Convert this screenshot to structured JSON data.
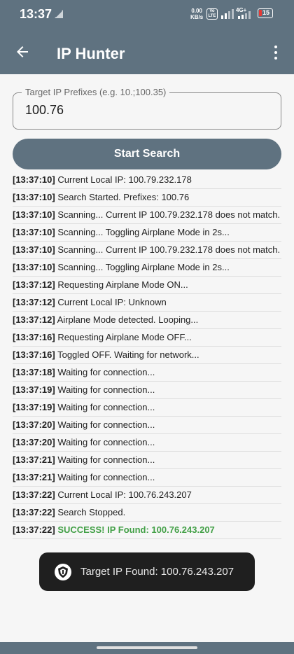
{
  "status_bar": {
    "time": "13:37",
    "net_speed_value": "0.00",
    "net_speed_unit": "KB/s",
    "volte_label_top": "Vo",
    "volte_label_bottom": "LTE",
    "network_type": "4G+",
    "battery_level": "15",
    "icons": [
      "signal-small-icon",
      "signal-bars-icon",
      "battery-icon"
    ]
  },
  "app_bar": {
    "title": "IP Hunter",
    "back_icon": "arrow-back-icon",
    "menu_icon": "more-vert-icon"
  },
  "target_input": {
    "label": "Target IP Prefixes (e.g. 10.;100.35)",
    "value": "100.76"
  },
  "start_button": {
    "label": "Start Search"
  },
  "log": [
    {
      "ts": "[13:37:10]",
      "msg": "Current Local IP: 100.79.232.178"
    },
    {
      "ts": "[13:37:10]",
      "msg": "Search Started. Prefixes: 100.76"
    },
    {
      "ts": "[13:37:10]",
      "msg": "Scanning... Current IP 100.79.232.178 does not match."
    },
    {
      "ts": "[13:37:10]",
      "msg": "Scanning... Toggling Airplane Mode in 2s..."
    },
    {
      "ts": "[13:37:10]",
      "msg": "Scanning... Current IP 100.79.232.178 does not match."
    },
    {
      "ts": "[13:37:10]",
      "msg": "Scanning... Toggling Airplane Mode in 2s..."
    },
    {
      "ts": "[13:37:12]",
      "msg": "Requesting Airplane Mode ON..."
    },
    {
      "ts": "[13:37:12]",
      "msg": "Current Local IP: Unknown"
    },
    {
      "ts": "[13:37:12]",
      "msg": "Airplane Mode detected. Looping..."
    },
    {
      "ts": "[13:37:16]",
      "msg": "Requesting Airplane Mode OFF..."
    },
    {
      "ts": "[13:37:16]",
      "msg": "Toggled OFF. Waiting for network..."
    },
    {
      "ts": "[13:37:18]",
      "msg": "Waiting for connection..."
    },
    {
      "ts": "[13:37:19]",
      "msg": "Waiting for connection..."
    },
    {
      "ts": "[13:37:19]",
      "msg": "Waiting for connection..."
    },
    {
      "ts": "[13:37:20]",
      "msg": "Waiting for connection..."
    },
    {
      "ts": "[13:37:20]",
      "msg": "Waiting for connection..."
    },
    {
      "ts": "[13:37:21]",
      "msg": "Waiting for connection..."
    },
    {
      "ts": "[13:37:21]",
      "msg": "Waiting for connection..."
    },
    {
      "ts": "[13:37:22]",
      "msg": "Current Local IP: 100.76.243.207"
    },
    {
      "ts": "[13:37:22]",
      "msg": "Search Stopped."
    },
    {
      "ts": "[13:37:22]",
      "msg": "SUCCESS! IP Found: 100.76.243.207",
      "success": true
    }
  ],
  "toast": {
    "icon": "app-shield-icon",
    "text": "Target IP Found: 100.76.243.207"
  },
  "colors": {
    "primary": "#5f7280",
    "success": "#43a047",
    "battery_low": "#e53935",
    "toast_bg": "#1f1f1f"
  }
}
